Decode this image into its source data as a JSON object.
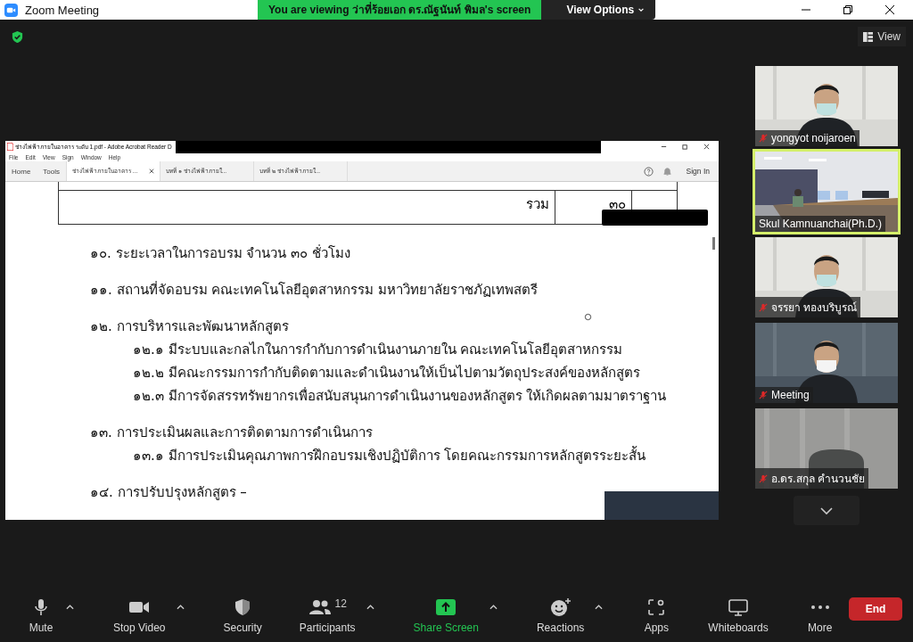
{
  "window": {
    "title": "Zoom Meeting"
  },
  "banner": {
    "text": "You are viewing ว่าที่ร้อยเอก ดร.ณัฐนันท์ พิมล's screen",
    "button": "View Options"
  },
  "view_button": "View",
  "shared_screen": {
    "window_title": "ช่างไฟฟ้าภายในอาคาร ระดับ 1.pdf - Adobe Acrobat Reader D",
    "menu": [
      "File",
      "Edit",
      "View",
      "Sign",
      "Window",
      "Help"
    ],
    "nav": [
      "Home",
      "Tools"
    ],
    "tabs": [
      {
        "label": "ช่างไฟฟ้าภายในอาคาร ...",
        "selected": true
      },
      {
        "label": "บทที่ ๑ ช่างไฟฟ้าภายใ...",
        "selected": false
      },
      {
        "label": "บทที่ ๒ ช่างไฟฟ้าภายใ...",
        "selected": false
      }
    ],
    "sign_in": "Sign In",
    "table_total_label": "รวม",
    "table_total_value": "๓๐",
    "lines": [
      {
        "kind": "heading",
        "text": "๑๐. ระยะเวลาในการอบรม   จำนวน ๓๐ ชั่วโมง"
      },
      {
        "kind": "heading",
        "text": "๑๑. สถานที่จัดอบรม  คณะเทคโนโลยีอุตสาหกรรม มหาวิทยาลัยราชภัฏเทพสตรี"
      },
      {
        "kind": "heading",
        "text": "๑๒. การบริหารและพัฒนาหลักสูตร"
      },
      {
        "kind": "sub",
        "text": "๑๒.๑ มีระบบและกลไกในการกำกับการดำเนินงานภายใน คณะเทคโนโลยีอุตสาหกรรม"
      },
      {
        "kind": "sub",
        "text": "๑๒.๒ มีคณะกรรมการกำกับติดตามและดำเนินงานให้เป็นไปตามวัตถุประสงค์ของหลักสูตร"
      },
      {
        "kind": "sub",
        "text": "๑๒.๓ มีการจัดสรรทรัพยากรเพื่อสนับสนุนการดำเนินงานของหลักสูตร ให้เกิดผลตามมาตราฐาน"
      },
      {
        "kind": "heading",
        "text": "๑๓. การประเมินผลและการติดตามการดำเนินการ"
      },
      {
        "kind": "sub",
        "text": "๑๓.๑ มีการประเมินคุณภาพการฝึกอบรมเชิงปฏิบัติการ โดยคณะกรรมการหลักสูตรระยะสั้น"
      },
      {
        "kind": "heading",
        "text": "๑๔. การปรับปรุงหลักสูตร –"
      }
    ]
  },
  "gallery": [
    {
      "name": "yongyot noijaroen",
      "muted": true,
      "selected": false,
      "kind": "person"
    },
    {
      "name": "Skul Kamnuanchai(Ph.D.)",
      "muted": false,
      "selected": true,
      "kind": "room"
    },
    {
      "name": "จรรยา ทองบริบูรณ์",
      "muted": true,
      "selected": false,
      "kind": "person"
    },
    {
      "name": "Meeting",
      "muted": true,
      "selected": false,
      "kind": "person"
    },
    {
      "name": "อ.ดร.สกุล คำนวนชัย",
      "muted": true,
      "selected": false,
      "kind": "chair"
    }
  ],
  "toolbar": [
    {
      "kind": "mic",
      "label": "Mute",
      "caret": true
    },
    {
      "kind": "video",
      "label": "Stop Video",
      "caret": true
    },
    {
      "kind": "security",
      "label": "Security",
      "caret": false
    },
    {
      "kind": "participants",
      "label": "Participants",
      "count": "12",
      "caret": true
    },
    {
      "kind": "share",
      "label": "Share Screen",
      "caret": true
    },
    {
      "kind": "reactions",
      "label": "Reactions",
      "caret": true
    },
    {
      "kind": "apps",
      "label": "Apps",
      "caret": false
    },
    {
      "kind": "whiteboards",
      "label": "Whiteboards",
      "caret": false
    },
    {
      "kind": "more",
      "label": "More",
      "caret": false
    }
  ],
  "end_button": "End"
}
